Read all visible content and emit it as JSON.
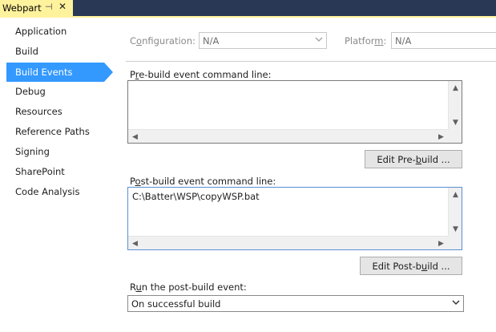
{
  "tab": {
    "title": "Webpart",
    "pin_glyph": "⊣",
    "close_glyph": "✕"
  },
  "sidebar": {
    "items": [
      {
        "label": "Application"
      },
      {
        "label": "Build"
      },
      {
        "label": "Build Events",
        "selected": true
      },
      {
        "label": "Debug"
      },
      {
        "label": "Resources"
      },
      {
        "label": "Reference Paths"
      },
      {
        "label": "Signing"
      },
      {
        "label": "SharePoint"
      },
      {
        "label": "Code Analysis"
      }
    ]
  },
  "main": {
    "configuration": {
      "label_pre": "C",
      "label_key": "o",
      "label_post": "nfiguration:",
      "value": "N/A"
    },
    "platform": {
      "label_pre": "Platfor",
      "label_key": "m",
      "label_post": ":",
      "value": "N/A"
    },
    "prebuild": {
      "label_pre": "P",
      "label_key": "r",
      "label_post": "e-build event command line:",
      "value": ""
    },
    "edit_prebuild": {
      "pre": "Edit Pre-",
      "key": "b",
      "post": "uild ..."
    },
    "postbuild": {
      "label_pre": "P",
      "label_key": "o",
      "label_post": "st-build event command line:",
      "value": "C:\\Batter\\WSP\\copyWSP.bat"
    },
    "edit_postbuild": {
      "pre": "Edit Post-b",
      "key": "u",
      "post": "ild ..."
    },
    "run_event": {
      "label_pre": "R",
      "label_key": "u",
      "label_post": "n the post-build event:",
      "value": "On successful build"
    }
  },
  "colors": {
    "tab_strip": "#293955",
    "tab_active": "#fff29d",
    "selection": "#3399ff"
  }
}
